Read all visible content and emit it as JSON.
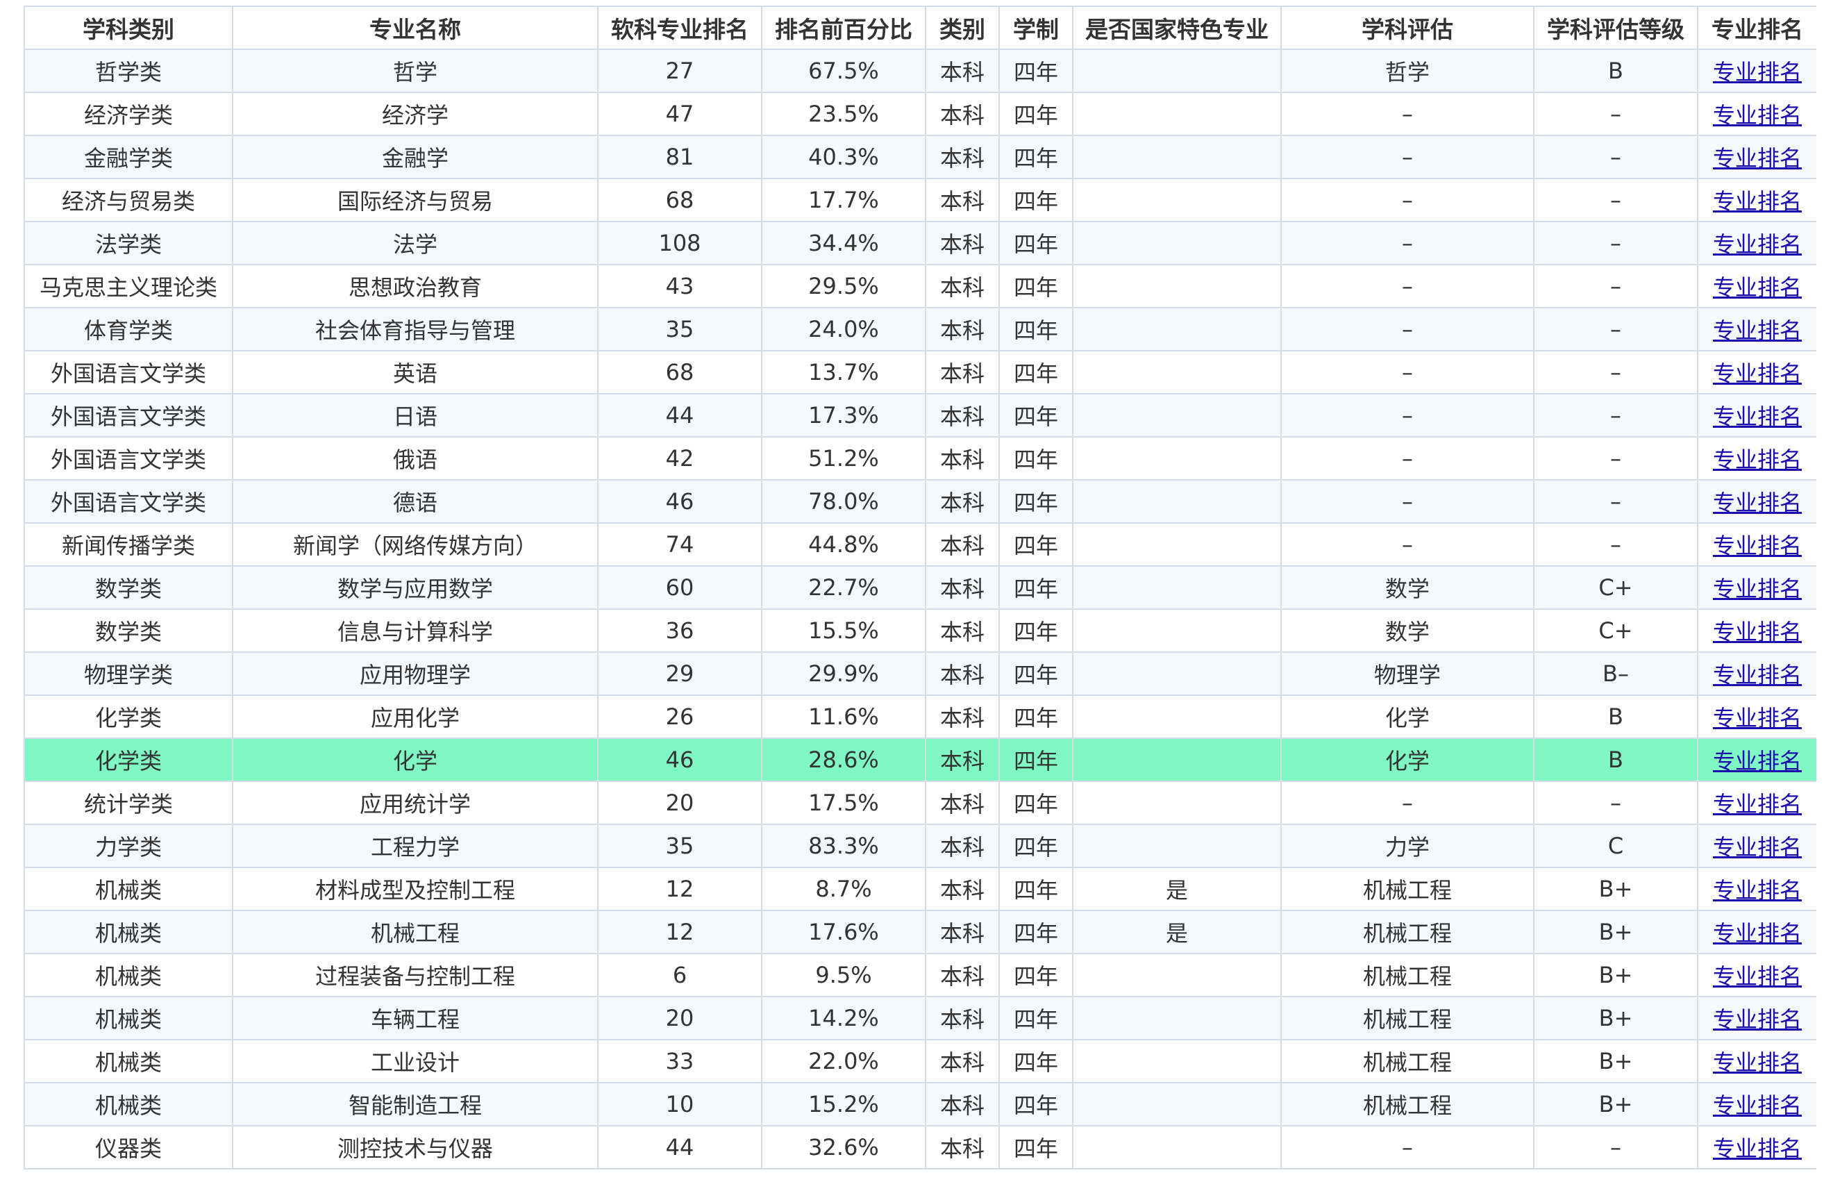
{
  "table": {
    "columns": [
      "学科类别",
      "专业名称",
      "软科专业排名",
      "排名前百分比",
      "类别",
      "学制",
      "是否国家特色专业",
      "学科评估",
      "学科评估等级",
      "专业排名"
    ],
    "highlight_row": 16,
    "rows": [
      [
        "哲学类",
        "哲学",
        "27",
        "67.5%",
        "本科",
        "四年",
        "",
        "哲学",
        "B",
        "专业排名"
      ],
      [
        "经济学类",
        "经济学",
        "47",
        "23.5%",
        "本科",
        "四年",
        "",
        "–",
        "–",
        "专业排名"
      ],
      [
        "金融学类",
        "金融学",
        "81",
        "40.3%",
        "本科",
        "四年",
        "",
        "–",
        "–",
        "专业排名"
      ],
      [
        "经济与贸易类",
        "国际经济与贸易",
        "68",
        "17.7%",
        "本科",
        "四年",
        "",
        "–",
        "–",
        "专业排名"
      ],
      [
        "法学类",
        "法学",
        "108",
        "34.4%",
        "本科",
        "四年",
        "",
        "–",
        "–",
        "专业排名"
      ],
      [
        "马克思主义理论类",
        "思想政治教育",
        "43",
        "29.5%",
        "本科",
        "四年",
        "",
        "–",
        "–",
        "专业排名"
      ],
      [
        "体育学类",
        "社会体育指导与管理",
        "35",
        "24.0%",
        "本科",
        "四年",
        "",
        "–",
        "–",
        "专业排名"
      ],
      [
        "外国语言文学类",
        "英语",
        "68",
        "13.7%",
        "本科",
        "四年",
        "",
        "–",
        "–",
        "专业排名"
      ],
      [
        "外国语言文学类",
        "日语",
        "44",
        "17.3%",
        "本科",
        "四年",
        "",
        "–",
        "–",
        "专业排名"
      ],
      [
        "外国语言文学类",
        "俄语",
        "42",
        "51.2%",
        "本科",
        "四年",
        "",
        "–",
        "–",
        "专业排名"
      ],
      [
        "外国语言文学类",
        "德语",
        "46",
        "78.0%",
        "本科",
        "四年",
        "",
        "–",
        "–",
        "专业排名"
      ],
      [
        "新闻传播学类",
        "新闻学（网络传媒方向）",
        "74",
        "44.8%",
        "本科",
        "四年",
        "",
        "–",
        "–",
        "专业排名"
      ],
      [
        "数学类",
        "数学与应用数学",
        "60",
        "22.7%",
        "本科",
        "四年",
        "",
        "数学",
        "C+",
        "专业排名"
      ],
      [
        "数学类",
        "信息与计算科学",
        "36",
        "15.5%",
        "本科",
        "四年",
        "",
        "数学",
        "C+",
        "专业排名"
      ],
      [
        "物理学类",
        "应用物理学",
        "29",
        "29.9%",
        "本科",
        "四年",
        "",
        "物理学",
        "B–",
        "专业排名"
      ],
      [
        "化学类",
        "应用化学",
        "26",
        "11.6%",
        "本科",
        "四年",
        "",
        "化学",
        "B",
        "专业排名"
      ],
      [
        "化学类",
        "化学",
        "46",
        "28.6%",
        "本科",
        "四年",
        "",
        "化学",
        "B",
        "专业排名"
      ],
      [
        "统计学类",
        "应用统计学",
        "20",
        "17.5%",
        "本科",
        "四年",
        "",
        "–",
        "–",
        "专业排名"
      ],
      [
        "力学类",
        "工程力学",
        "35",
        "83.3%",
        "本科",
        "四年",
        "",
        "力学",
        "C",
        "专业排名"
      ],
      [
        "机械类",
        "材料成型及控制工程",
        "12",
        "8.7%",
        "本科",
        "四年",
        "是",
        "机械工程",
        "B+",
        "专业排名"
      ],
      [
        "机械类",
        "机械工程",
        "12",
        "17.6%",
        "本科",
        "四年",
        "是",
        "机械工程",
        "B+",
        "专业排名"
      ],
      [
        "机械类",
        "过程装备与控制工程",
        "6",
        "9.5%",
        "本科",
        "四年",
        "",
        "机械工程",
        "B+",
        "专业排名"
      ],
      [
        "机械类",
        "车辆工程",
        "20",
        "14.2%",
        "本科",
        "四年",
        "",
        "机械工程",
        "B+",
        "专业排名"
      ],
      [
        "机械类",
        "工业设计",
        "33",
        "22.0%",
        "本科",
        "四年",
        "",
        "机械工程",
        "B+",
        "专业排名"
      ],
      [
        "机械类",
        "智能制造工程",
        "10",
        "15.2%",
        "本科",
        "四年",
        "",
        "机械工程",
        "B+",
        "专业排名"
      ],
      [
        "仪器类",
        "测控技术与仪器",
        "44",
        "32.6%",
        "本科",
        "四年",
        "",
        "–",
        "–",
        "专业排名"
      ]
    ]
  }
}
